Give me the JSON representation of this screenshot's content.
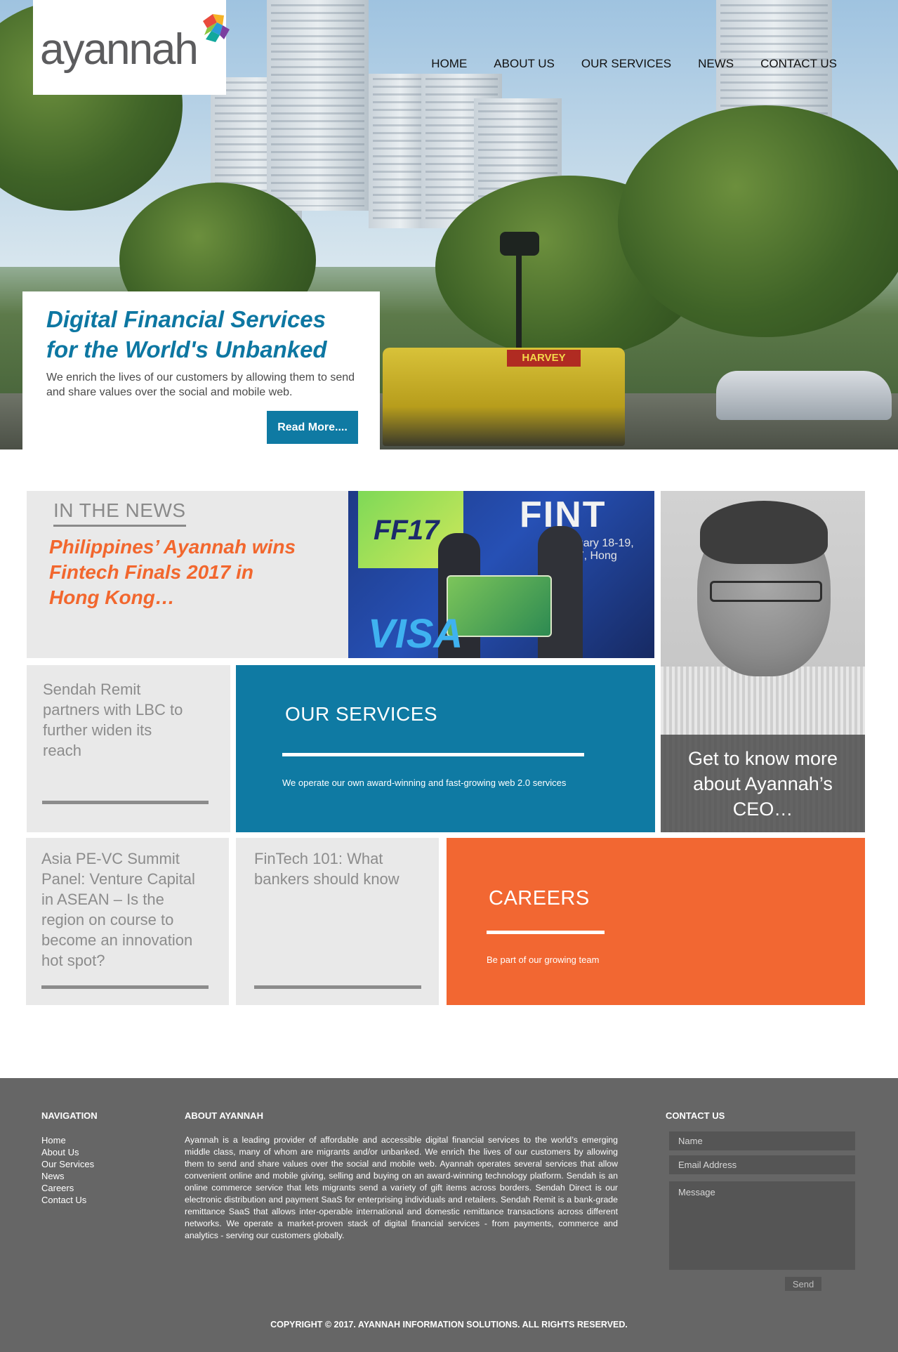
{
  "brand": {
    "name": "ayannah"
  },
  "nav": {
    "items": [
      "HOME",
      "ABOUT US",
      "OUR SERVICES",
      "NEWS",
      "CONTACT US"
    ]
  },
  "hero": {
    "title_line1": "Digital Financial Services",
    "title_line2": "for the World's Unbanked",
    "subtitle": "We enrich the lives of our customers by allowing them to send and share values over the social and mobile web.",
    "button": "Read More....",
    "photo_sign": "HARVEY"
  },
  "news": {
    "label": "IN THE NEWS",
    "headline": "Philippines’ Ayannah wins Fintech Finals 2017 in Hong Kong…",
    "photo_texts": {
      "ff": "FF17",
      "visa": "VISA",
      "fin": "FINT",
      "date": "January 18-19, 2017, Hong"
    }
  },
  "tiles": {
    "sendah": "Sendah Remit partners with LBC to further widen its reach",
    "asia": "Asia PE-VC Summit Panel: Venture Capital in ASEAN – Is the region on course to become an innovation hot spot?",
    "fintech": "FinTech 101: What bankers should know"
  },
  "services": {
    "title": "OUR SERVICES",
    "subtitle": "We operate our own award-winning and fast-growing web 2.0 services"
  },
  "ceo": {
    "text": "Get to know more about Ayannah’s CEO…"
  },
  "careers": {
    "title": "CAREERS",
    "subtitle": "Be part of our growing team"
  },
  "footer": {
    "nav_heading": "NAVIGATION",
    "nav_items": [
      "Home",
      "About Us",
      "Our Services",
      "News",
      "Careers",
      "Contact Us"
    ],
    "about_heading": "ABOUT AYANNAH",
    "about_text": "Ayannah is a leading provider of affordable and accessible digital financial services to the world’s emerging middle class, many of whom are migrants and/or unbanked. We enrich the lives of our customers by allowing them to send and share values over the social and mobile web. Ayannah operates several services that allow convenient online and mobile giving, selling and buying on an award-winning technology platform.  Sendah is an online commerce service that lets migrants send a variety of gift items across borders. Sendah Direct is our electronic distribution and payment SaaS for enterprising individuals and retailers.  Sendah Remit is a bank-grade remittance SaaS that allows inter-operable international and domestic remittance transactions across different networks.   We operate a market-proven stack of digital financial services - from payments, commerce and analytics - serving our customers globally.",
    "contact_heading": "CONTACT US",
    "name_placeholder": "Name",
    "email_placeholder": "Email Address",
    "message_placeholder": "Message",
    "send_label": "Send",
    "copyright": "COPYRIGHT © 2017. AYANNAH INFORMATION SOLUTIONS. ALL RIGHTS RESERVED."
  },
  "colors": {
    "brand_blue": "#0f7aa3",
    "accent_orange": "#f26732",
    "footer_gray": "#666666",
    "tile_gray": "#e9e9e9"
  }
}
